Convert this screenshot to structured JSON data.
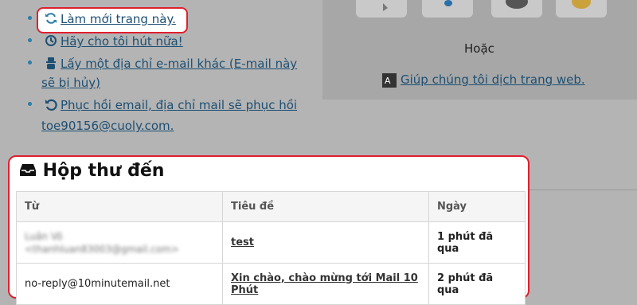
{
  "actions": {
    "refresh": "Làm mới trang này.",
    "more_time": "Hãy cho tôi hút nữa!",
    "other_email_line1": "Lấy một địa chỉ e-mail khác (E-mail này",
    "other_email_line2": "sẽ bị hủy)",
    "recover_line1": "Phục hồi email, địa chỉ mail sẽ phục hồi",
    "recover_line2": "toe90156@cuoly.com."
  },
  "right_panel": {
    "or_text": "Hoặc",
    "translate_link": "Giúp chúng tôi dịch trang web."
  },
  "inbox": {
    "title": "Hộp thư đến",
    "columns": [
      "Từ",
      "Tiêu đề",
      "Ngày"
    ],
    "rows": [
      {
        "from": "Luân Võ",
        "from_email": "<thanhluan83003@gmail.com>",
        "subject": "test",
        "date": "1 phút đã qua"
      },
      {
        "from": "no-reply@10minutemail.net",
        "subject_line1": "Xin chào, chào mừng tới Mail 10",
        "subject_line2": "Phút",
        "date": "2 phút đã qua"
      }
    ]
  },
  "colors": {
    "highlight": "#e0202e",
    "link": "#1d4f73",
    "overlay": "#b4b4b4"
  }
}
